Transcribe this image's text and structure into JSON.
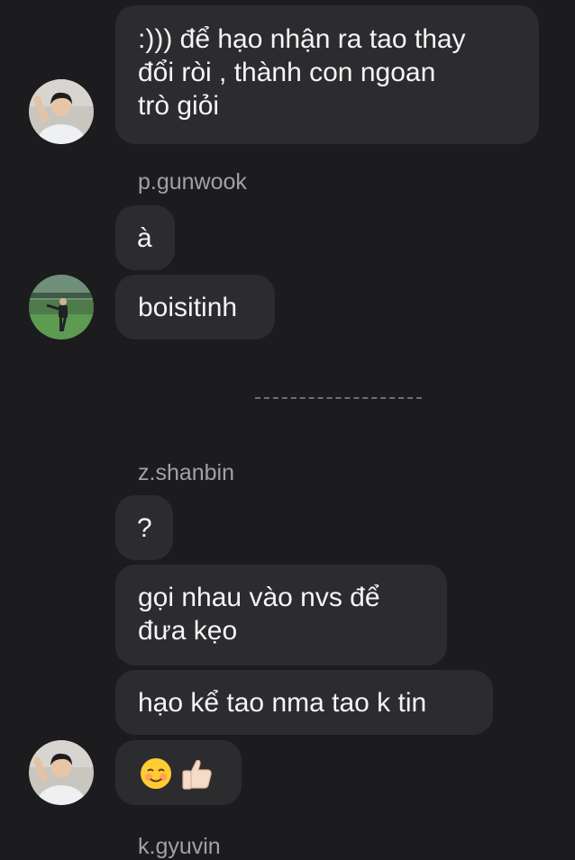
{
  "conversation": {
    "messages": [
      {
        "id": "m1",
        "text": ":))) để hạo nhận ra tao thay\nđổi ròi , thành con ngoan\ntrò giỏi"
      },
      {
        "id": "m2",
        "text": "à"
      },
      {
        "id": "m3",
        "text": "boisitinh"
      },
      {
        "id": "m4",
        "text": "?"
      },
      {
        "id": "m5",
        "text": " gọi nhau vào nvs để\nđưa kẹo"
      },
      {
        "id": "m6",
        "text": "hạo kể tao nma tao k tin"
      },
      {
        "id": "m7",
        "emoji": [
          "smiling-face-icon",
          "thumbs-up-icon"
        ]
      }
    ],
    "senders": {
      "s1": "p.gunwook",
      "s2": "z.shanbin",
      "s3": "k.gyuvin"
    }
  },
  "colors": {
    "background": "#1c1c1e",
    "bubble": "#2c2c2e",
    "sender_text": "#a1a1a6",
    "message_text": "#f5f5f7"
  }
}
